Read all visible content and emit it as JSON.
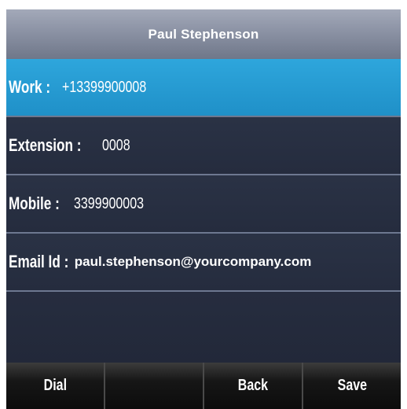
{
  "title": "Paul Stephenson",
  "rows": [
    {
      "label": "Work :",
      "value": "+13399900008",
      "selected": true
    },
    {
      "label": "Extension :",
      "value": "0008",
      "selected": false
    },
    {
      "label": "Mobile :",
      "value": "3399900003",
      "selected": false
    },
    {
      "label": "Email Id :",
      "value": "paul.stephenson@yourcompany.com",
      "selected": false
    }
  ],
  "softkeys": [
    "Dial",
    "",
    "Back",
    "Save"
  ],
  "colors": {
    "selected_row": "#2ea6dc",
    "row_background": "#262d3f",
    "title_bar": "#8b92a4",
    "softkey_bar": "#141414"
  }
}
